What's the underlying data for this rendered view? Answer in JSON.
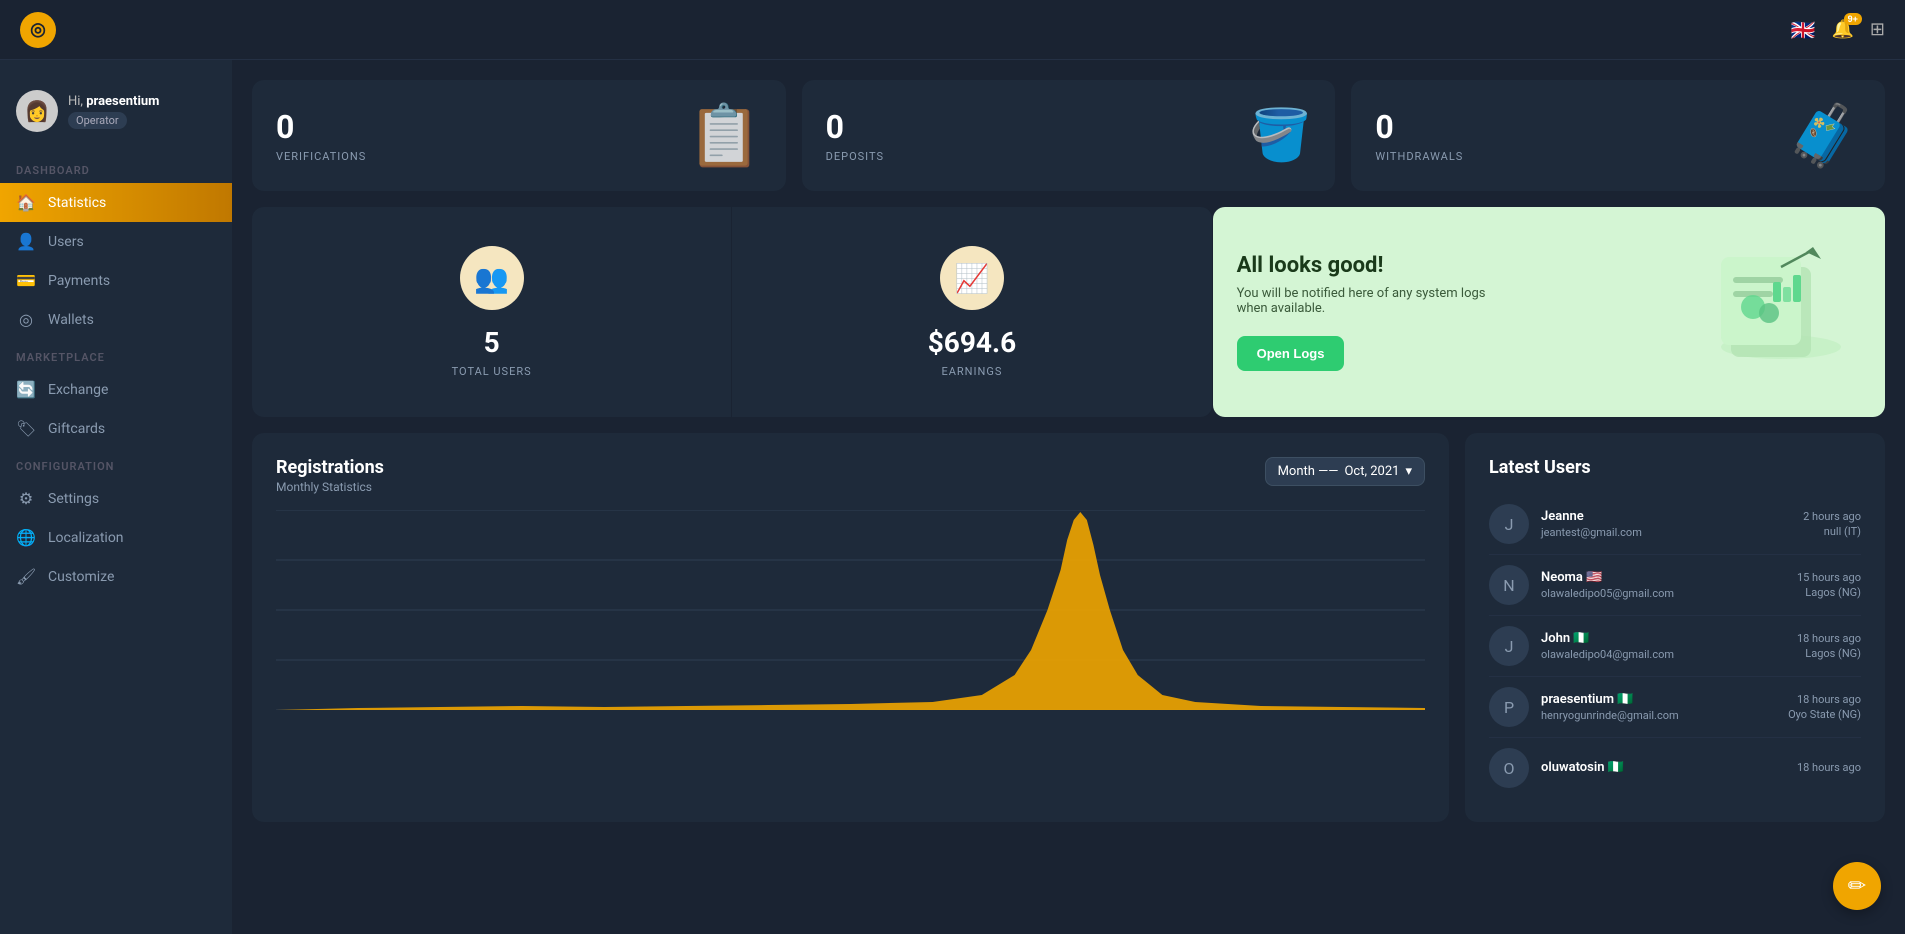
{
  "topbar": {
    "logo_symbol": "◎",
    "flag": "🇬🇧",
    "notification_badge": "9+",
    "grid_icon": "⊞"
  },
  "sidebar": {
    "user": {
      "greeting_prefix": "Hi, ",
      "username": "praesentium",
      "role": "Operator",
      "avatar_emoji": "👩"
    },
    "sections": [
      {
        "label": "DASHBOARD",
        "items": [
          {
            "id": "statistics",
            "label": "Statistics",
            "icon": "🏠",
            "active": true
          },
          {
            "id": "users",
            "label": "Users",
            "icon": "👤"
          },
          {
            "id": "payments",
            "label": "Payments",
            "icon": "💳"
          },
          {
            "id": "wallets",
            "label": "Wallets",
            "icon": "◎"
          }
        ]
      },
      {
        "label": "MARKETPLACE",
        "items": [
          {
            "id": "exchange",
            "label": "Exchange",
            "icon": "🔄"
          },
          {
            "id": "giftcards",
            "label": "Giftcards",
            "icon": "🏷"
          }
        ]
      },
      {
        "label": "CONFIGURATION",
        "items": [
          {
            "id": "settings",
            "label": "Settings",
            "icon": "⚙"
          },
          {
            "id": "localization",
            "label": "Localization",
            "icon": "🌐"
          },
          {
            "id": "customize",
            "label": "Customize",
            "icon": "🖌"
          }
        ]
      }
    ]
  },
  "stats_top": [
    {
      "id": "verifications",
      "value": "0",
      "label": "VERIFICATIONS",
      "emoji": "📋"
    },
    {
      "id": "deposits",
      "value": "0",
      "label": "DEPOSITS",
      "emoji": "🪣"
    },
    {
      "id": "withdrawals",
      "value": "0",
      "label": "WITHDRAWALS",
      "emoji": "🧳"
    }
  ],
  "metrics": [
    {
      "id": "total-users",
      "value": "5",
      "label": "TOTAL USERS",
      "icon": "👥"
    },
    {
      "id": "earnings",
      "value": "$694.6",
      "label": "EARNINGS",
      "icon": "📈"
    }
  ],
  "all_looks_good": {
    "title": "All looks good!",
    "subtitle": "You will be notified here of any system logs when available.",
    "button_label": "Open Logs"
  },
  "registrations": {
    "title": "Registrations",
    "subtitle": "Monthly Statistics",
    "month_label": "Oct, 2021"
  },
  "latest_users": {
    "title": "Latest Users",
    "users": [
      {
        "name": "Jeanne",
        "email": "jeantest@gmail.com",
        "ago": "2 hours ago",
        "location": "null (IT)",
        "flag": ""
      },
      {
        "name": "Neoma",
        "email": "olawaledipo05@gmail.com",
        "ago": "15 hours ago",
        "location": "Lagos (NG)",
        "flag": "🇺🇸"
      },
      {
        "name": "John",
        "email": "olawaledipo04@gmail.com",
        "ago": "18 hours ago",
        "location": "Lagos (NG)",
        "flag": "🇳🇬"
      },
      {
        "name": "praesentium",
        "email": "henryogunrinde@gmail.com",
        "ago": "18 hours ago",
        "location": "Oyo State (NG)",
        "flag": "🇳🇬"
      },
      {
        "name": "oluwatosin",
        "email": "",
        "ago": "18 hours ago",
        "location": "",
        "flag": "🇳🇬"
      }
    ]
  },
  "fab": {
    "icon": "✏"
  }
}
